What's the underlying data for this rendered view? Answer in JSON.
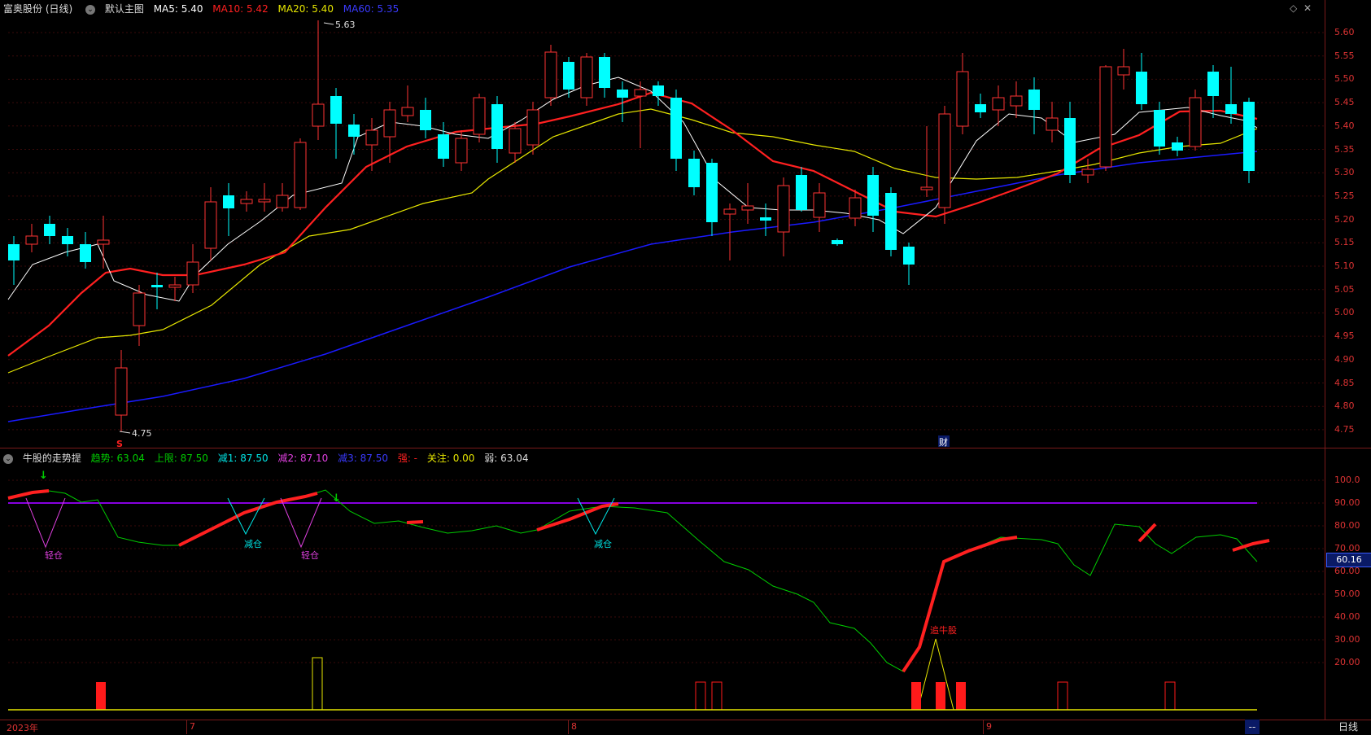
{
  "main_header": {
    "title": "富奥股份 (日线)",
    "indicator_name": "默认主图",
    "ma5": "MA5: 5.40",
    "ma10": "MA10: 5.42",
    "ma20": "MA20: 5.40",
    "ma60": "MA60: 5.35"
  },
  "sub_header": {
    "title": "牛股的走势提",
    "trend": "趋势: 63.04",
    "upper": "上限: 87.50",
    "reduce1": "减1: 87.50",
    "reduce2": "减2: 87.10",
    "reduce3": "减3: 87.50",
    "strong": "强: -",
    "focus": "关注: 0.00",
    "weak": "弱: 63.04"
  },
  "price_axis": [
    "5.60",
    "5.55",
    "5.50",
    "5.45",
    "5.40",
    "5.35",
    "5.30",
    "5.25",
    "5.20",
    "5.15",
    "5.10",
    "5.05",
    "5.00",
    "4.95",
    "4.90",
    "4.85",
    "4.80",
    "4.75"
  ],
  "sub_axis": [
    "100.0",
    "90.00",
    "80.00",
    "70.00",
    "60.00",
    "50.00",
    "40.00",
    "30.00",
    "20.00"
  ],
  "annotations": {
    "high_label": "5.63",
    "low_label": "4.75",
    "cai_marker": "财",
    "s_marker": "S",
    "light_reduce_1": "轻仓",
    "reduce_1": "减仓",
    "light_reduce_2": "轻仓",
    "reduce_2": "减仓",
    "chase_bull": "追牛股"
  },
  "sub_price_tag": "60.16",
  "date_axis": {
    "year": "2023年",
    "m7": "7",
    "m8": "8",
    "m9": "9"
  },
  "tabs": {
    "daily": "日线",
    "dash": "--"
  },
  "colors": {
    "up": "#ff3333",
    "down": "#00ffff",
    "ma5": "#ffffff",
    "ma10": "#ff2020",
    "ma20": "#e6e600",
    "ma60": "#1a1aff",
    "trend": "#00cc00",
    "upper": "#9900ff"
  }
}
